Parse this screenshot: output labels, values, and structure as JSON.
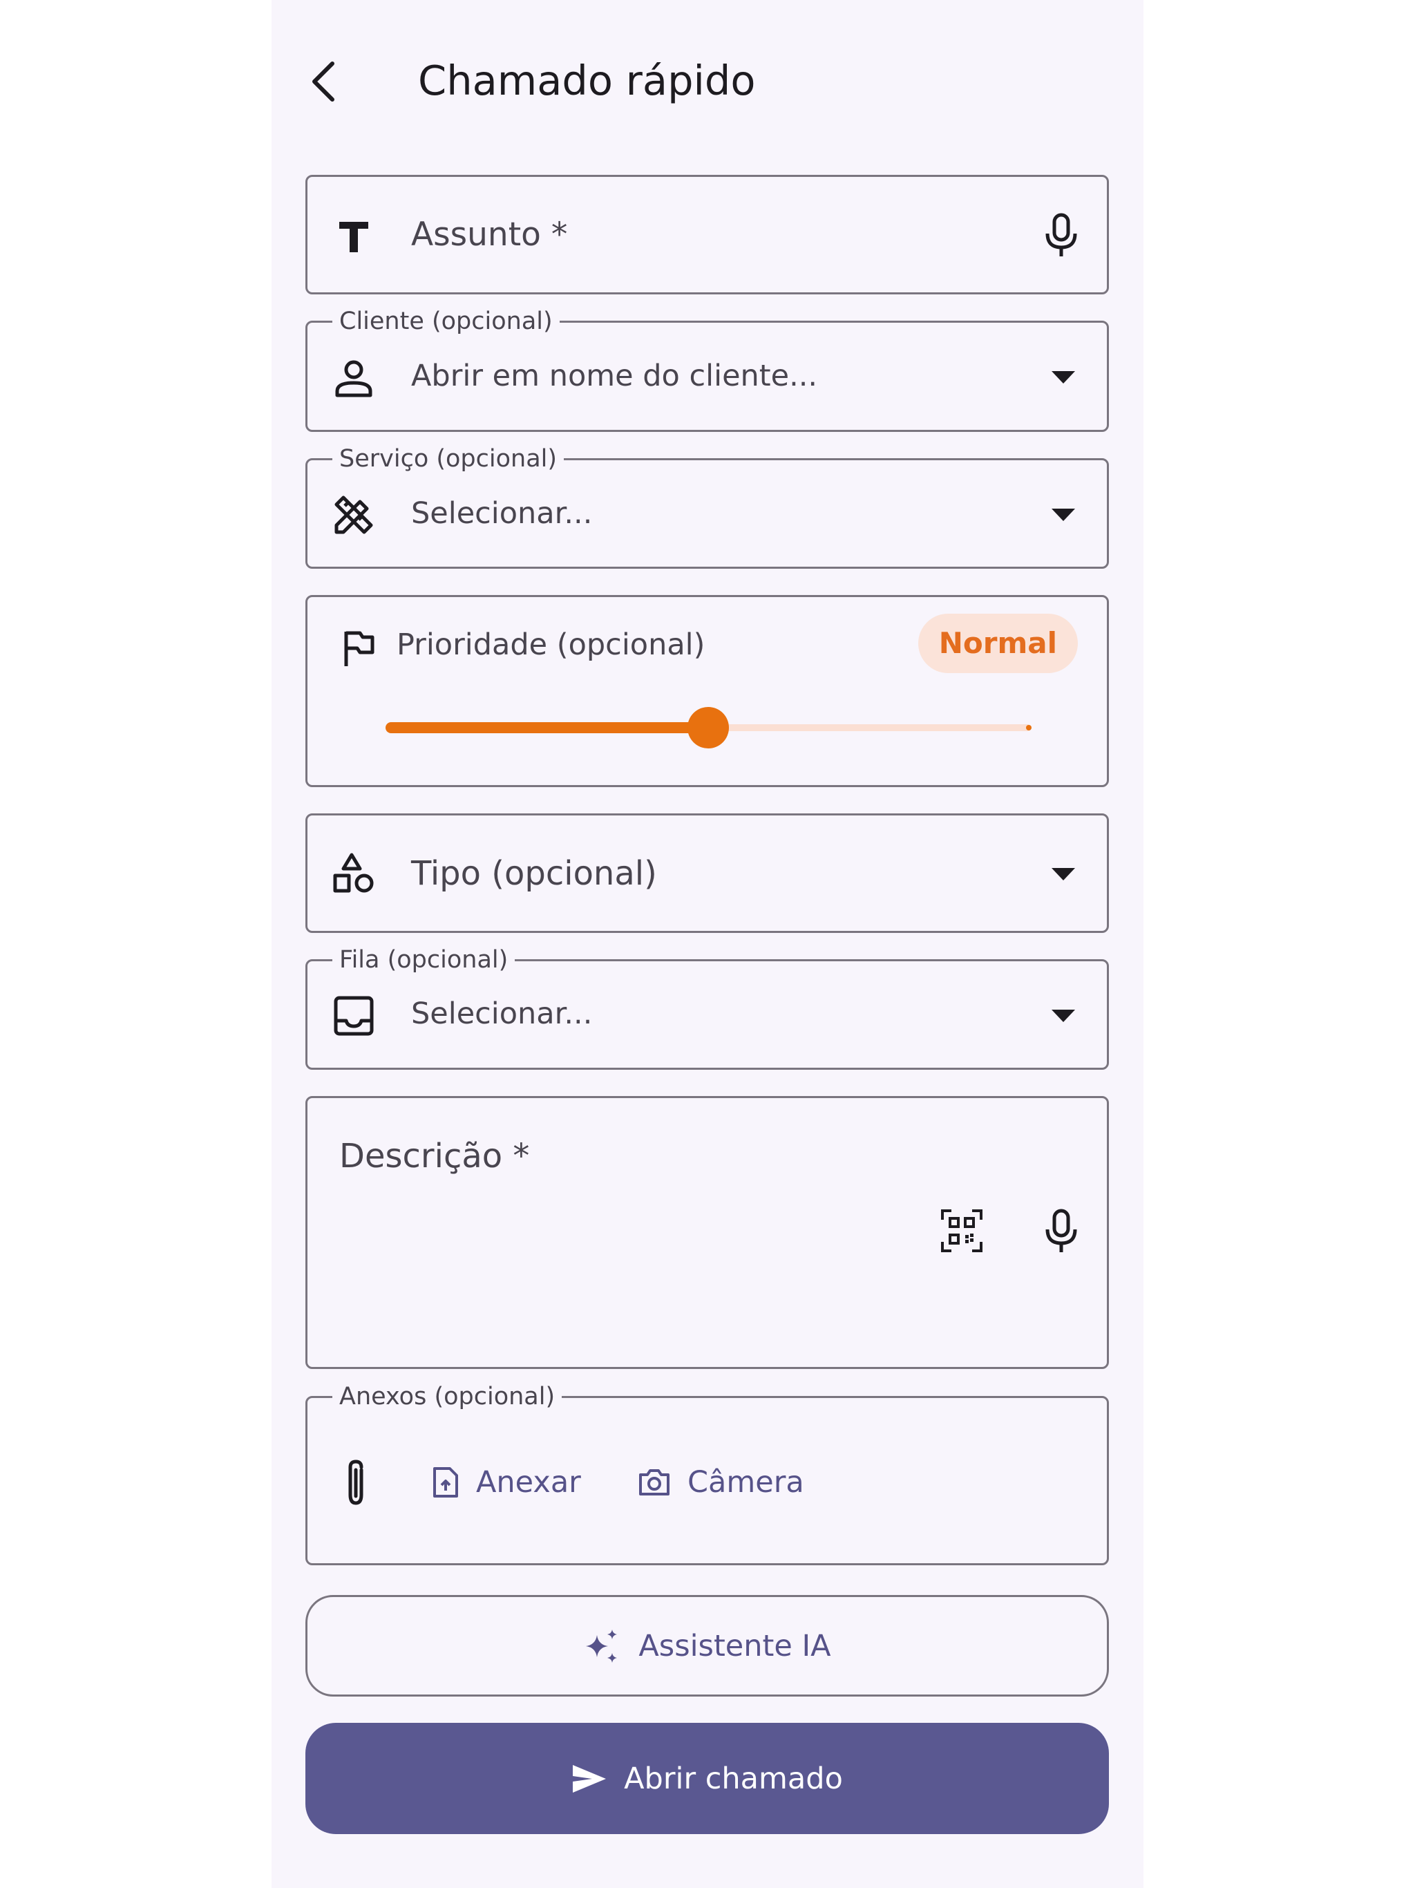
{
  "header": {
    "title": "Chamado rápido",
    "back_icon": "arrow-back-icon"
  },
  "fields": {
    "assunto": {
      "placeholder": "Assunto *",
      "icon": "text-format-icon",
      "action_icon": "microphone-icon"
    },
    "cliente": {
      "label": "Cliente (opcional)",
      "placeholder": "Abrir em nome do cliente...",
      "icon": "person-icon"
    },
    "servico": {
      "label": "Serviço (opcional)",
      "placeholder": "Selecionar...",
      "icon": "design-services-icon"
    },
    "prioridade": {
      "label": "Prioridade (opcional)",
      "value_label": "Normal",
      "icon": "flag-icon",
      "level": 0.5
    },
    "tipo": {
      "placeholder": "Tipo (opcional)",
      "icon": "category-icon"
    },
    "fila": {
      "label": "Fila (opcional)",
      "placeholder": "Selecionar...",
      "icon": "inbox-icon"
    },
    "descricao": {
      "placeholder": "Descrição *",
      "scan_icon": "qr-code-scanner-icon",
      "mic_icon": "microphone-icon"
    },
    "anexos": {
      "label": "Anexos (opcional)",
      "icon": "paperclip-icon",
      "attach_label": "Anexar",
      "camera_label": "Câmera"
    }
  },
  "actions": {
    "assistant_label": "Assistente IA",
    "submit_label": "Abrir chamado"
  },
  "colors": {
    "accent": "#5a5891",
    "priority": "#e8710f",
    "priority_bg": "#fbe3d9",
    "background": "#f8f5fc"
  }
}
